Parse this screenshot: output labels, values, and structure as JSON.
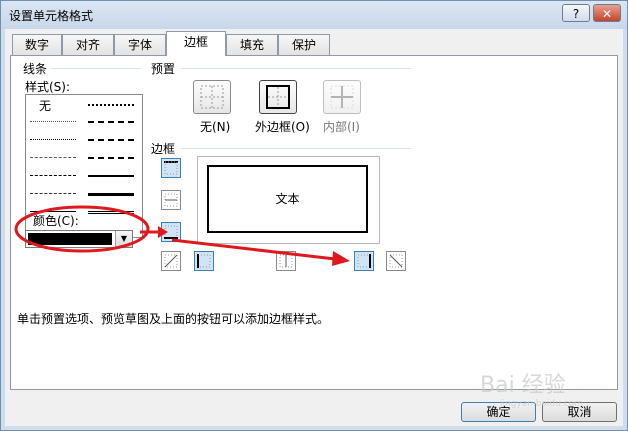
{
  "window": {
    "title": "设置单元格格式",
    "help_label": "?",
    "close_label": "✕"
  },
  "tabs": [
    {
      "label": "数字"
    },
    {
      "label": "对齐"
    },
    {
      "label": "字体"
    },
    {
      "label": "边框",
      "active": true
    },
    {
      "label": "填充"
    },
    {
      "label": "保护"
    }
  ],
  "line_section": {
    "title": "线条",
    "style_label": "样式(S):",
    "none_label": "无",
    "color_label": "颜色(C):",
    "color_value": "#000000"
  },
  "presets": {
    "title": "预置",
    "none_label": "无(N)",
    "outline_label": "外边框(O)",
    "inside_label": "内部(I)"
  },
  "border_section": {
    "title": "边框",
    "preview_text": "文本"
  },
  "hint": "单击预置选项、预览草图及上面的按钮可以添加边框样式。",
  "buttons": {
    "ok": "确定",
    "cancel": "取消"
  },
  "annotation_color": "#e0191e",
  "watermark": "Bai 经验 jingyan.baidu.com"
}
